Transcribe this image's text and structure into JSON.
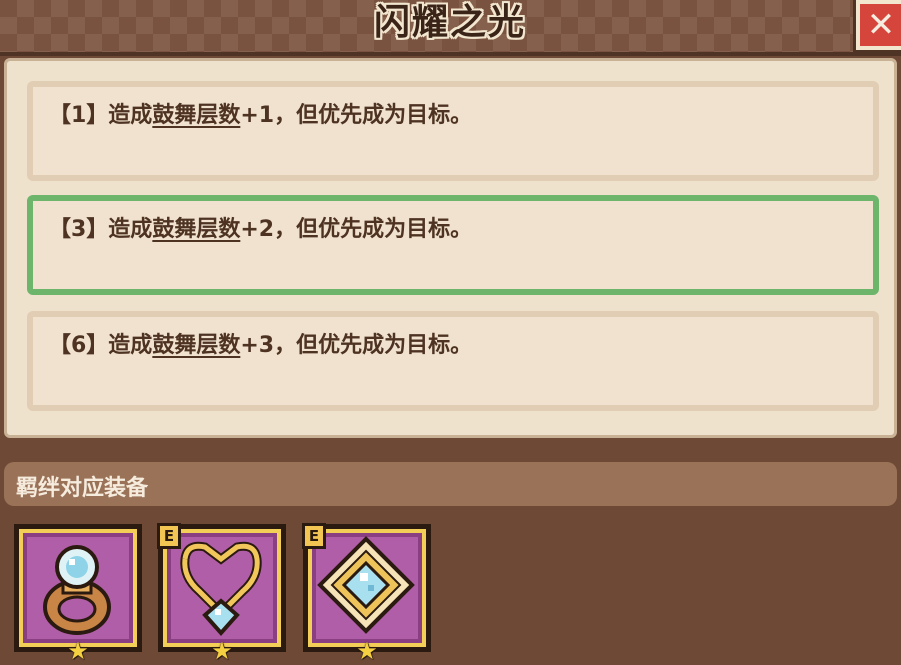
{
  "title": "闪耀之光",
  "close_label": "✕",
  "tiers": [
    {
      "prefix": "【1】造成",
      "keyword": "鼓舞层数",
      "suffix": "+1，但优先成为目标。",
      "active": false
    },
    {
      "prefix": "【3】造成",
      "keyword": "鼓舞层数",
      "suffix": "+2，但优先成为目标。",
      "active": true
    },
    {
      "prefix": "【6】造成",
      "keyword": "鼓舞层数",
      "suffix": "+3，但优先成为目标。",
      "active": false
    }
  ],
  "section_label": "羁绊对应装备",
  "equipment": [
    {
      "icon": "ring-icon",
      "badge": "",
      "star": "★"
    },
    {
      "icon": "necklace-icon",
      "badge": "E",
      "star": "★"
    },
    {
      "icon": "crystal-ornament-icon",
      "badge": "E",
      "star": "★"
    }
  ]
}
